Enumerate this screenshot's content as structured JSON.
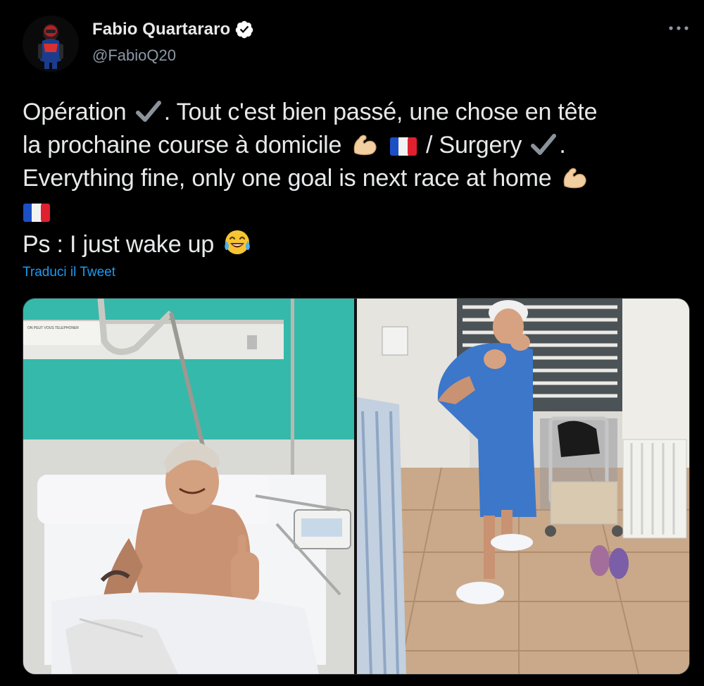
{
  "author": {
    "name": "Fabio Quartararo",
    "handle": "@FabioQ20",
    "avatar_icon": "rider-avatar-icon",
    "verified_icon": "verified-badge-icon"
  },
  "menu": {
    "icon": "more-options-icon"
  },
  "tweet": {
    "lines": [
      {
        "a": "Opération",
        "b": ". Tout c'est bien passé, une chose en tête"
      },
      {
        "a": "la prochaine course à domicile",
        "b": "/ Surgery",
        "c": "."
      },
      {
        "a": "Everything fine, only one goal is next race at home"
      },
      {
        "a": "Ps : I just wake up"
      }
    ],
    "emojis": [
      "check-mark-icon",
      "flexed-biceps-icon",
      "france-flag-icon",
      "face-with-tears-of-joy-icon"
    ]
  },
  "translate_label": "Traduci il Tweet",
  "media": {
    "photos": [
      {
        "name": "hospital-bed-photo",
        "sign_text": "ON PEUT VOUS TELEPHONER"
      },
      {
        "name": "boxing-pose-photo"
      }
    ]
  },
  "colors": {
    "background": "#000000",
    "text": "#e7e9ea",
    "muted": "#8b98a5",
    "link": "#1d9bf0",
    "verified": "#ffffff"
  }
}
